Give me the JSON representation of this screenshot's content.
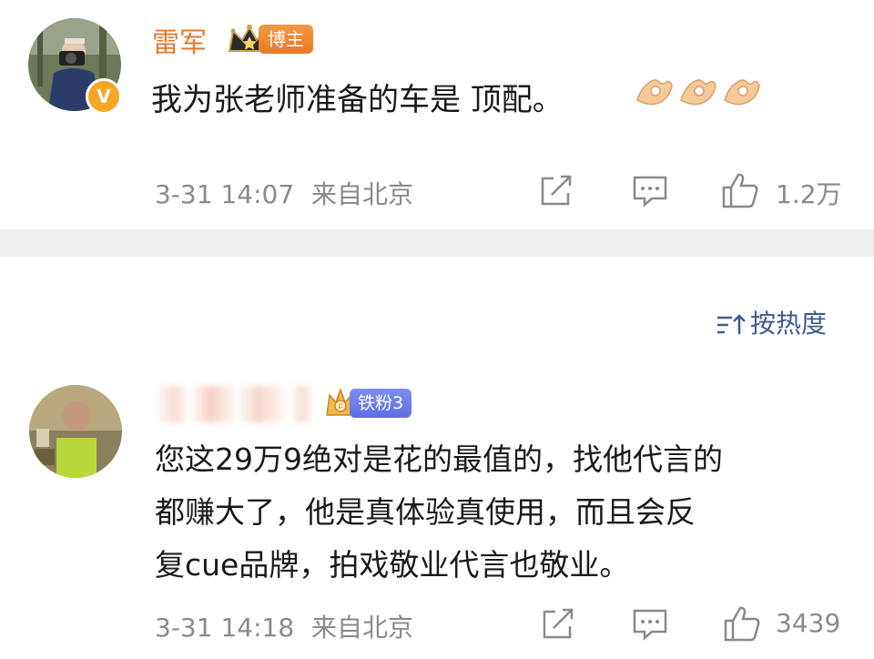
{
  "post": {
    "author": "雷军",
    "author_tag": "博主",
    "verified_mark": "V",
    "text": "我为张老师准备的车是 顶配。",
    "emoji": [
      "ok-hand-emoji",
      "ok-hand-emoji",
      "ok-hand-emoji"
    ],
    "time": "3-31 14:07",
    "location": "来自北京",
    "like_count": "1.2万",
    "icons": [
      "share-icon",
      "comment-icon",
      "like-icon"
    ]
  },
  "comments_header": {
    "sort_label": "按热度",
    "sort_icon": "sort-icon"
  },
  "comment": {
    "fan_tag": "铁粉3",
    "text_lines": [
      "您这29万9绝对是花的最值的，找他代言的",
      "都赚大了，他是真体验真使用，而且会反",
      "复cue品牌，拍戏敬业代言也敬业。"
    ],
    "time": "3-31 14:18",
    "location": "来自北京",
    "like_count": "3439",
    "icons": [
      "share-icon",
      "comment-icon",
      "like-icon"
    ]
  },
  "colors": {
    "author_name": "#e8782f",
    "meta_gray": "#8a8a8a",
    "sort_blue": "#3f5a8f",
    "divider": "#efeff1",
    "blogger_tag": "#ef8a32",
    "fan_tag": "#6a7aea"
  }
}
